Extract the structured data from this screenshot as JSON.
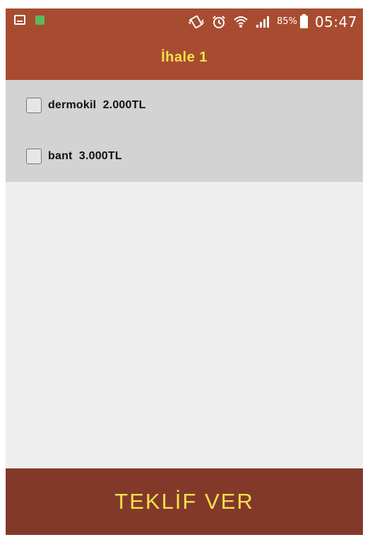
{
  "status_bar": {
    "battery_percent": "85%",
    "time": "05:47",
    "icons": [
      "gallery-icon",
      "notification-square-icon",
      "vibrate-icon",
      "alarm-icon",
      "wifi-icon",
      "signal-icon",
      "battery-icon"
    ]
  },
  "header": {
    "title": "İhale 1"
  },
  "items": [
    {
      "label": "dermokil  2.000TL",
      "checked": false
    },
    {
      "label": "bant  3.000TL",
      "checked": false
    }
  ],
  "action": {
    "label": "TEKLİF VER"
  },
  "colors": {
    "primary": "#a84c31",
    "primary_dark": "#82392a",
    "accent_text": "#f3e04a",
    "list_background": "#d3d3d3",
    "page_background": "#eeeeee"
  }
}
